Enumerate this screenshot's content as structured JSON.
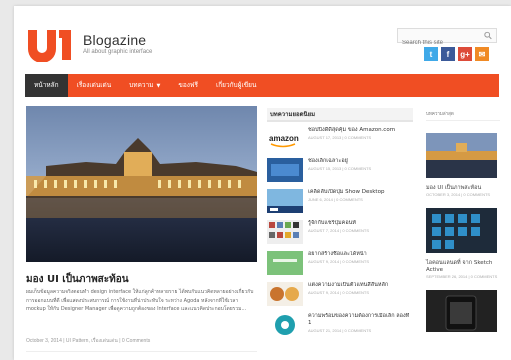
{
  "header": {
    "brand_name": "Blogazine",
    "tagline": "All about graphic interface",
    "search_placeholder": "Search this site"
  },
  "social": [
    {
      "icon": "twitter-icon",
      "glyph": "t",
      "color": "#3fa9e8"
    },
    {
      "icon": "facebook-icon",
      "glyph": "f",
      "color": "#3b5a99"
    },
    {
      "icon": "google-plus-icon",
      "glyph": "g+",
      "color": "#dd4b39"
    },
    {
      "icon": "email-icon",
      "glyph": "✉",
      "color": "#f08a24"
    }
  ],
  "nav": [
    {
      "label": "หน้าหลัก",
      "active": true
    },
    {
      "label": "เรื่องเด่นเด่น",
      "active": false
    },
    {
      "label": "บทความ",
      "active": false,
      "dropdown": true
    },
    {
      "label": "ของฟรี",
      "active": false
    },
    {
      "label": "เกี่ยวกับผู้เขียน",
      "active": false
    }
  ],
  "featured": {
    "title": "มอง UI เป็นภาพสะท้อน",
    "excerpt": "ผมเก็บข้อมูลความจริงตอนทำ design interface ให้แก่ลูกค้าหลายราย ได้พบกับแนวคิดหลายอย่างเกี่ยวกับการออกแบบที่ดี เพื่อแสดงประสบการณ์ การใช้งานที่น่าประทับใจ ระหว่าง Agoda หลังจากที่ใช้เวลา mockup ให้กับ Designer Manager เพื่อดูความถูกต้องของ Interface และแนวคิดประกอบโดยรวม...",
    "meta": "October 3, 2014 | UI Pattern, เรื่องเด่นเด่น | 0 Comments"
  },
  "middle": {
    "heading": "บทความยอดนิยม",
    "items": [
      {
        "title": "ชอปปิ้งดีดีสุดคุ้ม ของ Amazon.com",
        "meta": "AUGUST 17, 2013 | 0 COMMENTS",
        "thumb": "amazon"
      },
      {
        "title": "ช่องเล็กเฉลาะอยู่",
        "meta": "AUGUST 15, 2013 | 0 COMMENTS",
        "thumb": "blue"
      },
      {
        "title": "เคล็ดลับเปิดปุ่ม Show Desktop",
        "meta": "JUNE 6, 2014 | 0 COMMENTS",
        "thumb": "desktop"
      },
      {
        "title": "รู้จักกับแชร์ปุ่มคอนท์",
        "meta": "AUGUST 7, 2014 | 0 COMMENTS",
        "thumb": "grid"
      },
      {
        "title": "อยากสร้างชื่อและได้หน้า",
        "meta": "AUGUST 9, 2014 | 0 COMMENTS",
        "thumb": "green"
      },
      {
        "title": "แต่งความงามเป็นตัวแทนสีสันหลัก",
        "meta": "AUGUST 9, 2014 | 0 COMMENTS",
        "thumb": "food"
      },
      {
        "title": "ความพร้อมของความต้องการเมื่อเล็ก ลองที่ 1",
        "meta": "AUGUST 21, 2014 | 0 COMMENTS",
        "thumb": "dark"
      }
    ]
  },
  "right": {
    "heading": "บทความล่าสุด",
    "items": [
      {
        "title": "มอง UI เป็นภาพสะท้อน",
        "meta": "OCTOBER 3, 2014 | 0 COMMENTS"
      },
      {
        "title": "ไอคอนแลนดที่ จาก Sketch Active",
        "meta": "SEPTEMBER 26, 2014 | 0 COMMENTS"
      }
    ]
  }
}
